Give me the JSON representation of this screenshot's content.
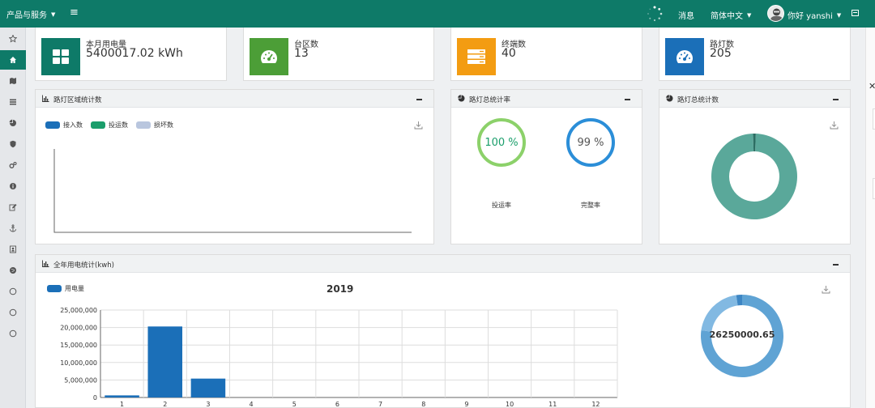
{
  "topbar": {
    "menu_label": "产品与服务",
    "messages_label": "消息",
    "language_label": "简体中文",
    "user_greeting": "你好 yanshi"
  },
  "sidebar": {
    "items": [
      {
        "icon": "star-icon"
      },
      {
        "icon": "home-icon",
        "active": true
      },
      {
        "icon": "map-icon"
      },
      {
        "icon": "list-icon"
      },
      {
        "icon": "pie-chart-icon"
      },
      {
        "icon": "shield-icon"
      },
      {
        "icon": "gears-icon"
      },
      {
        "icon": "info-icon"
      },
      {
        "icon": "edit-icon"
      },
      {
        "icon": "anchor-icon"
      },
      {
        "icon": "contact-card-icon"
      },
      {
        "icon": "globe-icon"
      },
      {
        "icon": "circle-icon"
      },
      {
        "icon": "circle-icon"
      },
      {
        "icon": "circle-icon"
      }
    ]
  },
  "stats": [
    {
      "label": "本月用电量",
      "value": "5400017.02 kWh",
      "icon": "grid-icon",
      "color": "#0e7a68"
    },
    {
      "label": "台区数",
      "value": "13",
      "icon": "dashboard-icon",
      "color": "#4c9e37"
    },
    {
      "label": "终端数",
      "value": "40",
      "icon": "server-icon",
      "color": "#f39c12"
    },
    {
      "label": "路灯数",
      "value": "205",
      "icon": "dashboard-icon",
      "color": "#1b6fb8"
    }
  ],
  "panels": {
    "region": {
      "title": "路灯区域统计数",
      "legend": [
        {
          "name": "接入数",
          "color": "#1b6fb8"
        },
        {
          "name": "投运数",
          "color": "#1a9e6b"
        },
        {
          "name": "损坏数",
          "color": "#b9c6de"
        }
      ]
    },
    "rate": {
      "title": "路灯总统计率",
      "gauges": [
        {
          "value": "100 %",
          "label": "投运率",
          "color": "#8cd16a",
          "text_color": "#1a9e6b"
        },
        {
          "value": "99 %",
          "label": "完整率",
          "color": "#2b8ed8",
          "text_color": "#555555"
        }
      ]
    },
    "total": {
      "title": "路灯总统计数"
    },
    "annual": {
      "title": "全年用电统计(kwh)",
      "legend_label": "用电量",
      "legend_color": "#1b6fb8",
      "center_value": "26250000.65"
    }
  },
  "chart_data": [
    {
      "type": "bar",
      "title": "2019",
      "categories": [
        "1",
        "2",
        "3",
        "4",
        "5",
        "6",
        "7",
        "8",
        "9",
        "10",
        "11",
        "12"
      ],
      "series": [
        {
          "name": "用电量",
          "values": [
            600000,
            20300000,
            5400000,
            0,
            0,
            0,
            0,
            0,
            0,
            0,
            0,
            0
          ]
        }
      ],
      "y_ticks": [
        "0",
        "5,000,000",
        "10,000,000",
        "15,000,000",
        "20,000,000",
        "25,000,000"
      ],
      "ylim": [
        0,
        25000000
      ],
      "color": "#1b6fb8"
    },
    {
      "type": "pie",
      "title": "",
      "values": [
        0.99,
        0.01
      ],
      "colors": [
        "#5aa89a",
        "#2c6e63"
      ]
    },
    {
      "type": "pie",
      "title": "26250000.65",
      "values": [
        20300000,
        5400000,
        600000
      ],
      "colors": [
        "#5fa3d4",
        "#82b9e2",
        "#3d86c4"
      ]
    }
  ]
}
